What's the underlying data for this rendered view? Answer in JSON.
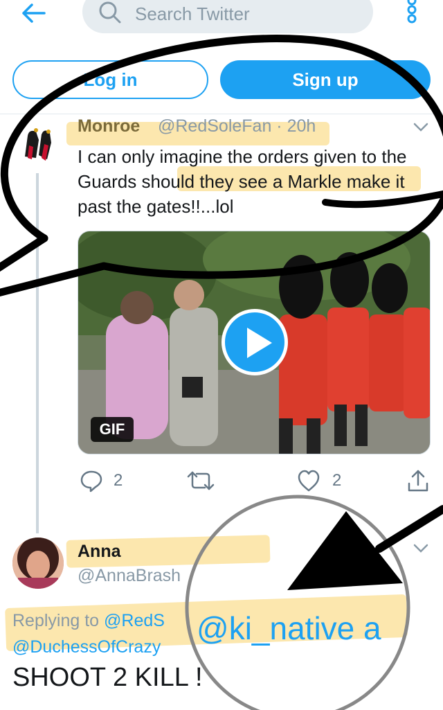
{
  "search": {
    "placeholder": "Search Twitter"
  },
  "auth": {
    "login_label": "Log in",
    "signup_label": "Sign up"
  },
  "tweet1": {
    "name": "Monroe",
    "handle": "@RedSoleFan · 20h",
    "text": "I can only imagine the orders given to the Guards should they see a Markle make it past the gates!!...lol",
    "media_badge": "GIF",
    "reply_count": "2",
    "like_count": "2"
  },
  "tweet2": {
    "name": "Anna",
    "handle": "@AnnaBrash",
    "replying_prefix": "Replying to ",
    "replying_mention_1": "@RedS",
    "replying_mention_2": "@DuchessOfCrazy",
    "text": "SHOOT 2 KILL !",
    "zoomed_mention": "@ki_native a"
  },
  "colors": {
    "accent": "#1da1f2",
    "highlight": "#fbe3a0",
    "muted": "#8899a6",
    "annotation": "#000000"
  },
  "icons": [
    "back-arrow-icon",
    "search-icon",
    "more-vertical-icon",
    "chevron-down-icon",
    "reply-icon",
    "retweet-icon",
    "like-icon",
    "share-icon",
    "play-icon"
  ]
}
